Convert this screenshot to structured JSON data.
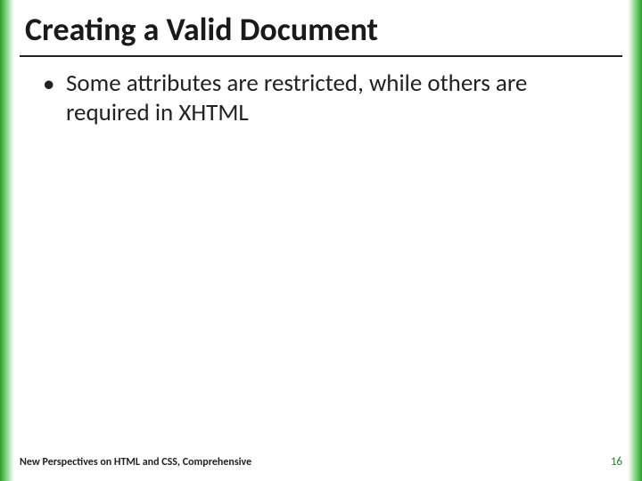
{
  "slide": {
    "title": "Creating a Valid Document",
    "bullets": [
      "Some attributes are restricted, while others are required in XHTML"
    ],
    "footer": {
      "source": "New Perspectives on HTML and CSS, Comprehensive",
      "page_number": "16"
    }
  }
}
